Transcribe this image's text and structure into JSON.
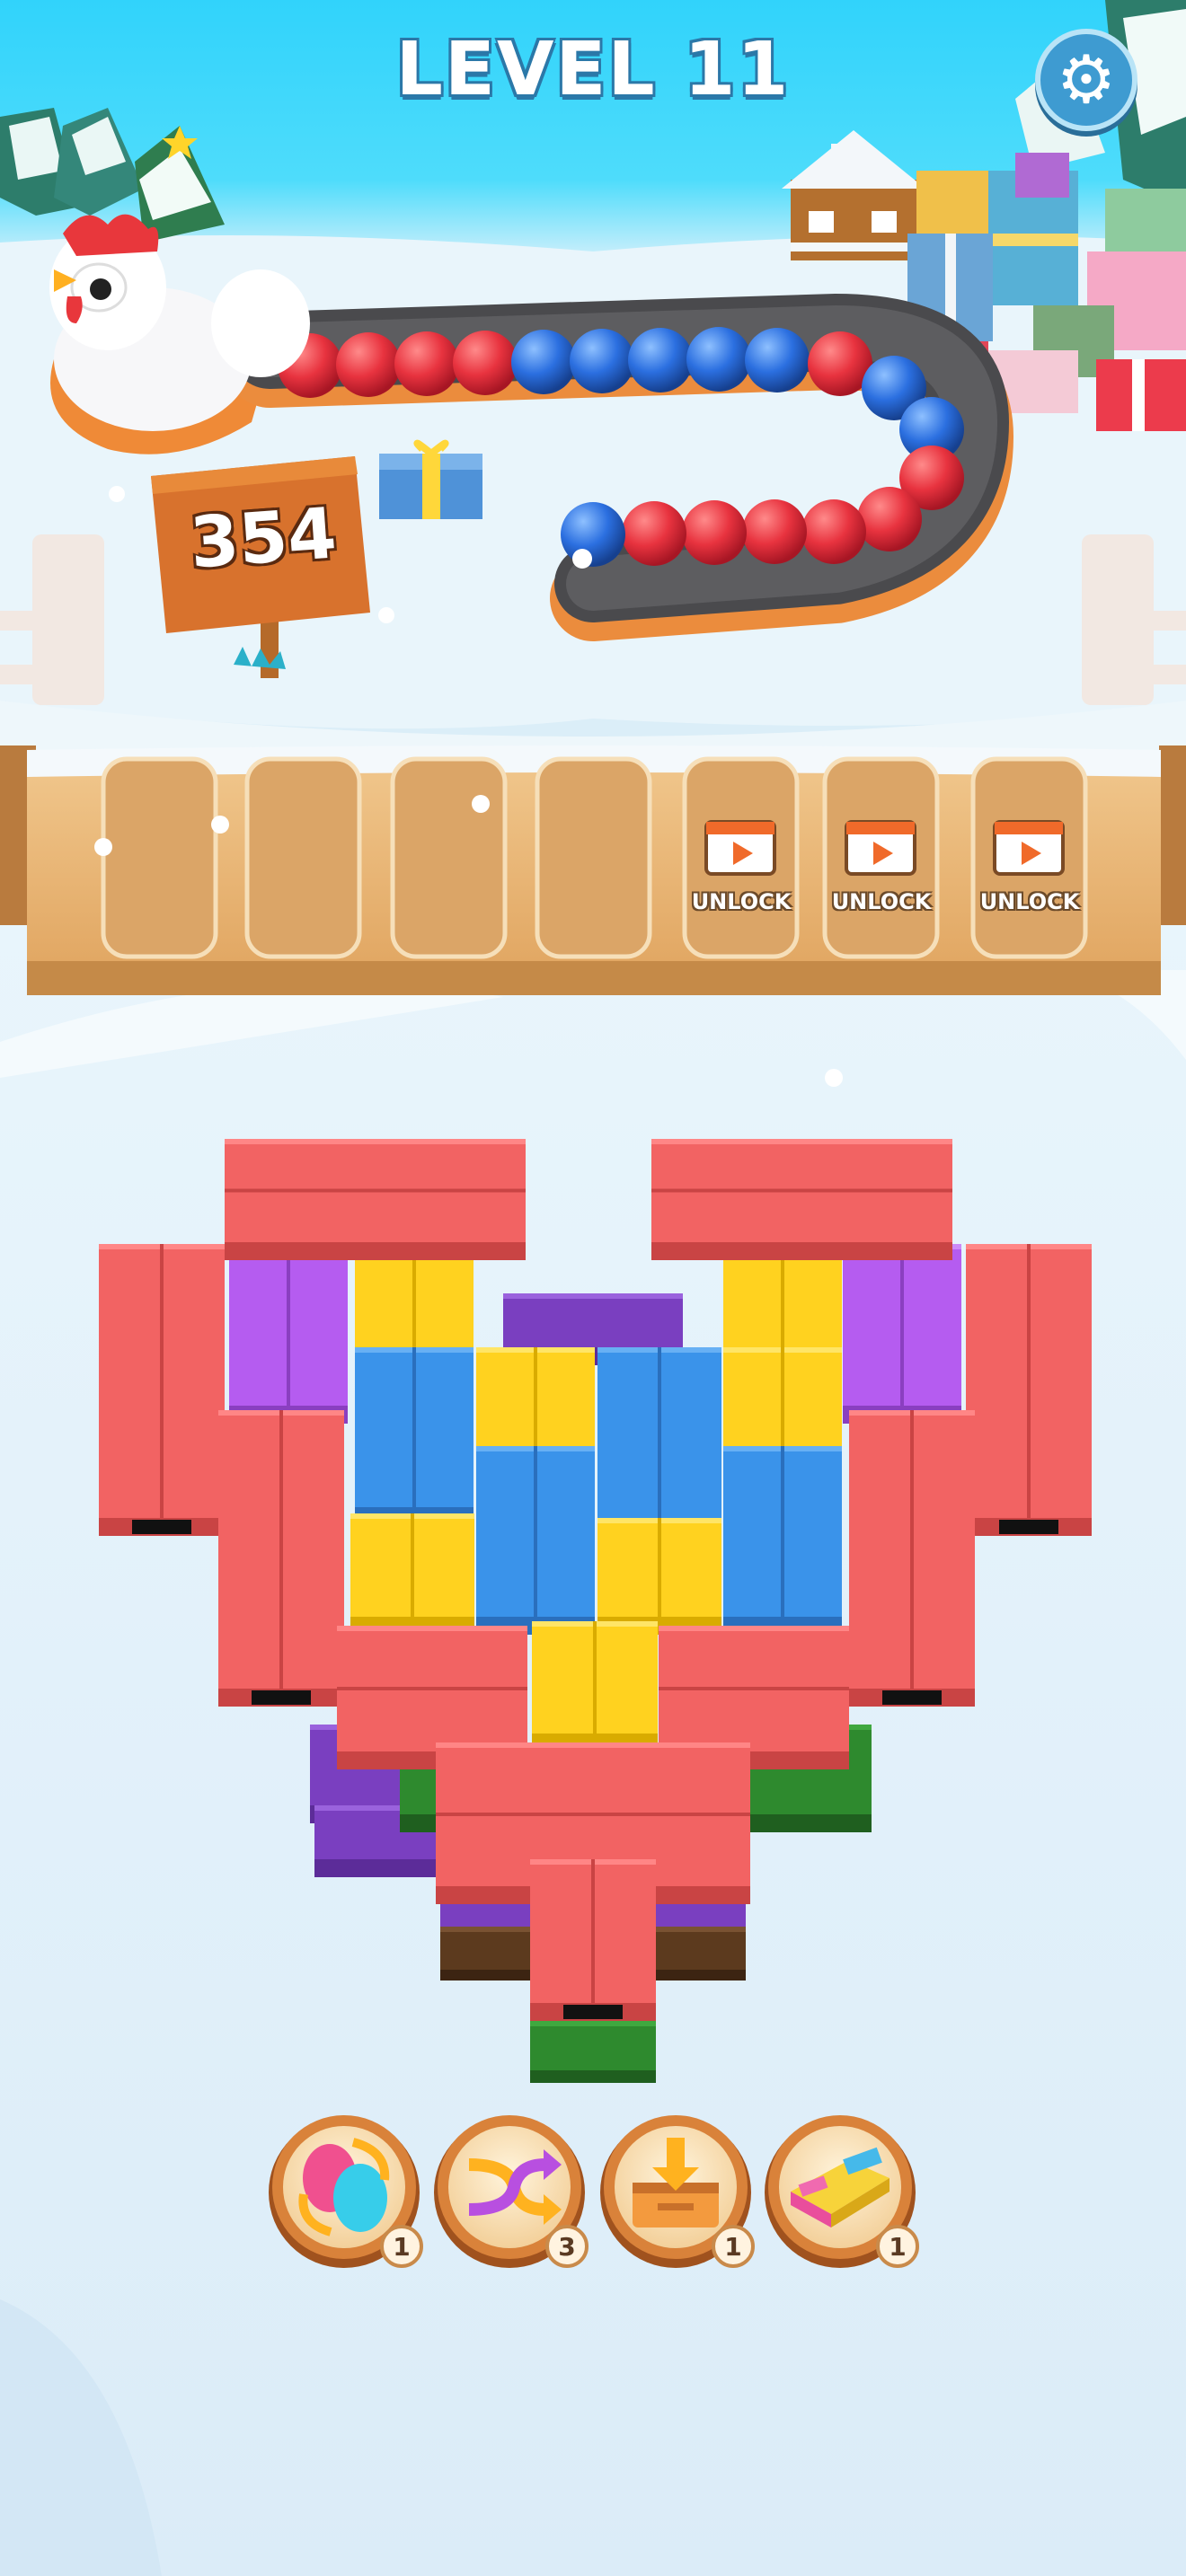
{
  "level": {
    "title": "LEVEL 11"
  },
  "settings": {
    "icon": "gear-icon"
  },
  "counter": {
    "value": "354"
  },
  "conveyor": {
    "balls": [
      "red",
      "red",
      "red",
      "red",
      "blue",
      "blue",
      "blue",
      "blue",
      "blue",
      "red",
      "blue",
      "blue",
      "red",
      "red",
      "red",
      "red",
      "red",
      "red",
      "blue"
    ]
  },
  "slots": {
    "open_count": 4,
    "locked": [
      {
        "label": "UNLOCK",
        "icon": "video-ad-icon"
      },
      {
        "label": "UNLOCK",
        "icon": "video-ad-icon"
      },
      {
        "label": "UNLOCK",
        "icon": "video-ad-icon"
      }
    ]
  },
  "boosters": [
    {
      "name": "color-swap",
      "icon": "color-swap-eggs-icon",
      "count": "1"
    },
    {
      "name": "shuffle",
      "icon": "shuffle-arrows-icon",
      "count": "3"
    },
    {
      "name": "drop-box",
      "icon": "drop-box-icon",
      "count": "1"
    },
    {
      "name": "tray",
      "icon": "tray-icon",
      "count": "1"
    }
  ],
  "colors": {
    "red_block": "#f26363",
    "yellow_block": "#ffd21f",
    "blue_block": "#3a93ea",
    "purple_block": "#b55cf0",
    "green_block": "#2e8a2e",
    "brown_block": "#5c3a1e",
    "red_ball": "#e8333f",
    "blue_ball": "#2b6fe0",
    "board": "#e9b677"
  }
}
